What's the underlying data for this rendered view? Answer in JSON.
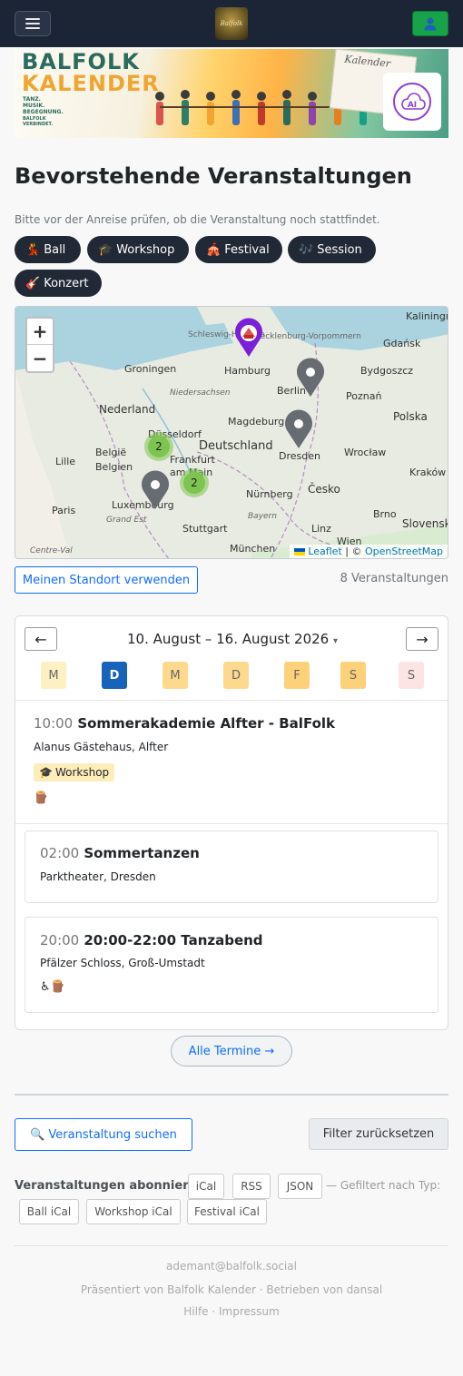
{
  "navbar": {
    "menu_icon": "hamburger-icon",
    "logo_text": "Balfolk",
    "user_icon": "user-icon",
    "accent": "#18a24a"
  },
  "banner": {
    "line1": "BALFOLK",
    "line2": "KALENDER",
    "tagline": "TANZ. MUSIK. BEGEGNUNG.",
    "slogan": "BALFOLK VERBINDET.",
    "calendar_word": "Kalender",
    "ai_badge": "AI"
  },
  "page": {
    "title": "Bevorstehende Veranstaltungen",
    "notice": "Bitte vor der Anreise prüfen, ob die Veranstaltung noch stattfindet."
  },
  "filters": [
    {
      "icon": "💃",
      "label": "Ball"
    },
    {
      "icon": "🎓",
      "label": "Workshop"
    },
    {
      "icon": "🎪",
      "label": "Festival"
    },
    {
      "icon": "🎶",
      "label": "Session"
    },
    {
      "icon": "🎸",
      "label": "Konzert"
    }
  ],
  "map": {
    "zoom_in": "+",
    "zoom_out": "−",
    "labels": [
      "Kaliningrad",
      "Gdańsk",
      "Schleswig-Holstein",
      "Mecklenburg-Vorpommern",
      "Groningen",
      "Hamburg",
      "Bydgoszcz",
      "Niedersachsen",
      "Berlin",
      "Poznań",
      "Nederland",
      "Magdeburg",
      "Polska",
      "Düsseldorf",
      "Deutschland",
      "Dresden",
      "België",
      "Belgien",
      "Lille",
      "Frankfurt am Main",
      "Wrocław",
      "Česko",
      "Kraków",
      "Luxembourg",
      "Nürnberg",
      "Paris",
      "Grand Est",
      "Bayern",
      "Stuttgart",
      "Linz",
      "Brno",
      "Slovensko",
      "Centre-Val",
      "München",
      "Wien"
    ],
    "cluster_counts": [
      "2",
      "2"
    ],
    "attribution_leaflet": "Leaflet",
    "attribution_sep": " | © ",
    "attribution_osm": "OpenStreetMap"
  },
  "location": {
    "button": "Meinen Standort verwenden",
    "count": "8 Veranstaltungen"
  },
  "calendar": {
    "prev": "←",
    "next": "→",
    "week_label": "10. August – 16. August 2026",
    "week_caret": "▾",
    "days": [
      {
        "letter": "M",
        "bg": "#fdf0c2",
        "color": "#666"
      },
      {
        "letter": "D",
        "bg": "#1863b9",
        "color": "#ffffff"
      },
      {
        "letter": "M",
        "bg": "#fdd98e",
        "color": "#666"
      },
      {
        "letter": "D",
        "bg": "#fdd98e",
        "color": "#666"
      },
      {
        "letter": "F",
        "bg": "#fdd07a",
        "color": "#666"
      },
      {
        "letter": "S",
        "bg": "#fdd07a",
        "color": "#666"
      },
      {
        "letter": "S",
        "bg": "#fce4e4",
        "color": "#666"
      }
    ],
    "events": [
      {
        "time": "10:00",
        "title": "Sommerakademie Alfter - BalFolk",
        "location": "Alanus Gästehaus, Alfter",
        "tag_icon": "🎓",
        "tag": "Workshop",
        "icons": "🪵"
      },
      {
        "time": "02:00",
        "title": "Sommertanzen",
        "location": "Parktheater, Dresden"
      },
      {
        "time": "20:00",
        "title": "20:00-22:00 Tanzabend",
        "location": "Pfälzer Schloss, Groß-Umstadt",
        "icons": "♿🪵"
      }
    ],
    "all_button": "Alle Termine →"
  },
  "search": {
    "button": "🔍 Veranstaltung suchen",
    "reset": "Filter zurücksetzen"
  },
  "subscribe": {
    "label": "Veranstaltungen abonnieren:",
    "formats": [
      "iCal",
      "RSS",
      "JSON"
    ],
    "filtered_text": "— Gefiltert nach Typ:",
    "type_feeds": [
      "Ball iCal",
      "Workshop iCal",
      "Festival iCal"
    ]
  },
  "footer": {
    "email": "ademant@balfolk.social",
    "presented": "Präsentiert von Balfolk Kalender · Betrieben von dansal",
    "links": "Hilfe · Impressum"
  }
}
